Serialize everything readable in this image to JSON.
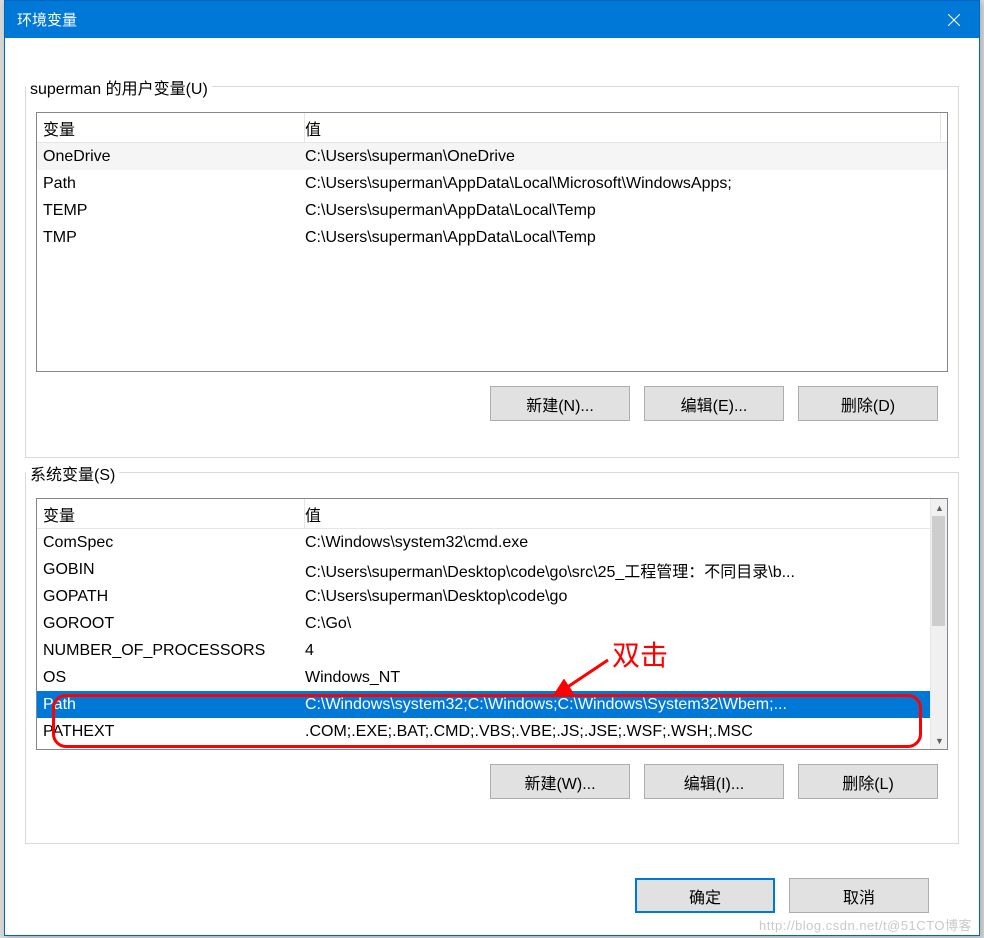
{
  "window": {
    "title": "环境变量"
  },
  "user_section": {
    "label": "superman 的用户变量(U)",
    "columns": {
      "var": "变量",
      "val": "值"
    },
    "rows": [
      {
        "var": "OneDrive",
        "val": "C:\\Users\\superman\\OneDrive"
      },
      {
        "var": "Path",
        "val": "C:\\Users\\superman\\AppData\\Local\\Microsoft\\WindowsApps;"
      },
      {
        "var": "TEMP",
        "val": "C:\\Users\\superman\\AppData\\Local\\Temp"
      },
      {
        "var": "TMP",
        "val": "C:\\Users\\superman\\AppData\\Local\\Temp"
      }
    ],
    "buttons": {
      "new": "新建(N)...",
      "edit": "编辑(E)...",
      "delete": "删除(D)"
    }
  },
  "system_section": {
    "label": "系统变量(S)",
    "columns": {
      "var": "变量",
      "val": "值"
    },
    "rows": [
      {
        "var": "ComSpec",
        "val": "C:\\Windows\\system32\\cmd.exe"
      },
      {
        "var": "GOBIN",
        "val": "C:\\Users\\superman\\Desktop\\code\\go\\src\\25_工程管理：不同目录\\b..."
      },
      {
        "var": "GOPATH",
        "val": "C:\\Users\\superman\\Desktop\\code\\go"
      },
      {
        "var": "GOROOT",
        "val": "C:\\Go\\"
      },
      {
        "var": "NUMBER_OF_PROCESSORS",
        "val": "4"
      },
      {
        "var": "OS",
        "val": "Windows_NT"
      },
      {
        "var": "Path",
        "val": "C:\\Windows\\system32;C:\\Windows;C:\\Windows\\System32\\Wbem;..."
      },
      {
        "var": "PATHEXT",
        "val": ".COM;.EXE;.BAT;.CMD;.VBS;.VBE;.JS;.JSE;.WSF;.WSH;.MSC"
      }
    ],
    "buttons": {
      "new": "新建(W)...",
      "edit": "编辑(I)...",
      "delete": "删除(L)"
    }
  },
  "footer": {
    "ok": "确定",
    "cancel": "取消"
  },
  "annotation": {
    "text": "双击"
  },
  "watermark": "http://blog.csdn.net/t@51CTO博客"
}
